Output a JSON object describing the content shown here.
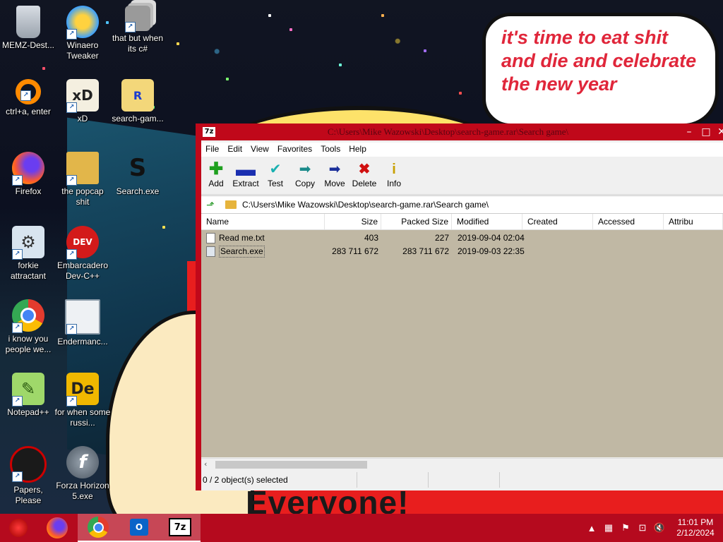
{
  "desktop": {
    "icons": [
      {
        "label": "MEMZ-Dest...",
        "icon": "recycle-bin-icon"
      },
      {
        "label": "Winaero Tweaker",
        "icon": "winaero-icon"
      },
      {
        "label": "that but when its c#",
        "icon": "stack-windows-icon"
      },
      {
        "label": "ctrl+a, enter",
        "icon": "ring-icon"
      },
      {
        "label": "xD",
        "icon": "hxd-icon"
      },
      {
        "label": "search-gam...",
        "icon": "rar-archive-icon"
      },
      {
        "label": "Firefox",
        "icon": "firefox-icon"
      },
      {
        "label": "the popcap shit",
        "icon": "folder-icon"
      },
      {
        "label": "Search.exe",
        "icon": "search-exe-icon"
      },
      {
        "label": "forkie attractant",
        "icon": "gear-monitor-icon"
      },
      {
        "label": "Embarcadero Dev-C++",
        "icon": "devcpp-icon"
      },
      {
        "label": "i know you people we...",
        "icon": "chrome-icon"
      },
      {
        "label": "Endermanc...",
        "icon": "window-icon"
      },
      {
        "label": "Notepad++",
        "icon": "notepadpp-icon"
      },
      {
        "label": "for when some russi...",
        "icon": "de-icon"
      },
      {
        "label": "Papers, Please",
        "icon": "papers-please-icon"
      },
      {
        "label": "Forza Horizon 5.exe",
        "icon": "flash-icon"
      }
    ],
    "wallpaper": {
      "bubble_text_1": "it's time to eat shit",
      "bubble_text_2": "and die and celebrate",
      "bubble_text_3": "the new year",
      "bottom_text": "Everyone!"
    }
  },
  "window": {
    "app_icon": "7z",
    "title": "C:\\Users\\Mike Wazowski\\Desktop\\search-game.rar\\Search game\\",
    "menu": [
      "File",
      "Edit",
      "View",
      "Favorites",
      "Tools",
      "Help"
    ],
    "toolbar": [
      {
        "label": "Add",
        "icon": "plus-icon",
        "color": "#1fa01f"
      },
      {
        "label": "Extract",
        "icon": "minus-icon",
        "color": "#1a2fb0"
      },
      {
        "label": "Test",
        "icon": "checkmark-icon",
        "color": "#19b0b0"
      },
      {
        "label": "Copy",
        "icon": "double-arrow-icon",
        "color": "#1a8a8a"
      },
      {
        "label": "Move",
        "icon": "arrow-right-icon",
        "color": "#1a2f9a"
      },
      {
        "label": "Delete",
        "icon": "x-icon",
        "color": "#d01010"
      },
      {
        "label": "Info",
        "icon": "info-icon",
        "color": "#c8a000"
      }
    ],
    "address": "C:\\Users\\Mike Wazowski\\Desktop\\search-game.rar\\Search game\\",
    "columns": [
      "Name",
      "Size",
      "Packed Size",
      "Modified",
      "Created",
      "Accessed",
      "Attribu"
    ],
    "files": [
      {
        "name": "Read me.txt",
        "size": "403",
        "packed": "227",
        "modified": "2019-09-04 02:04"
      },
      {
        "name": "Search.exe",
        "size": "283 711 672",
        "packed": "283 711 672",
        "modified": "2019-09-03 22:35"
      }
    ],
    "status": "0 / 2 object(s) selected"
  },
  "taskbar": {
    "items": [
      {
        "name": "start-button",
        "icon": "start-ornament-icon"
      },
      {
        "name": "firefox",
        "icon": "firefox-icon"
      },
      {
        "name": "chrome",
        "icon": "chrome-icon"
      },
      {
        "name": "outlook",
        "icon": "outlook-icon"
      },
      {
        "name": "7zip",
        "icon": "7zip-icon",
        "label": "7z"
      }
    ],
    "clock_time": "11:01 PM",
    "clock_date": "2/12/2024"
  }
}
